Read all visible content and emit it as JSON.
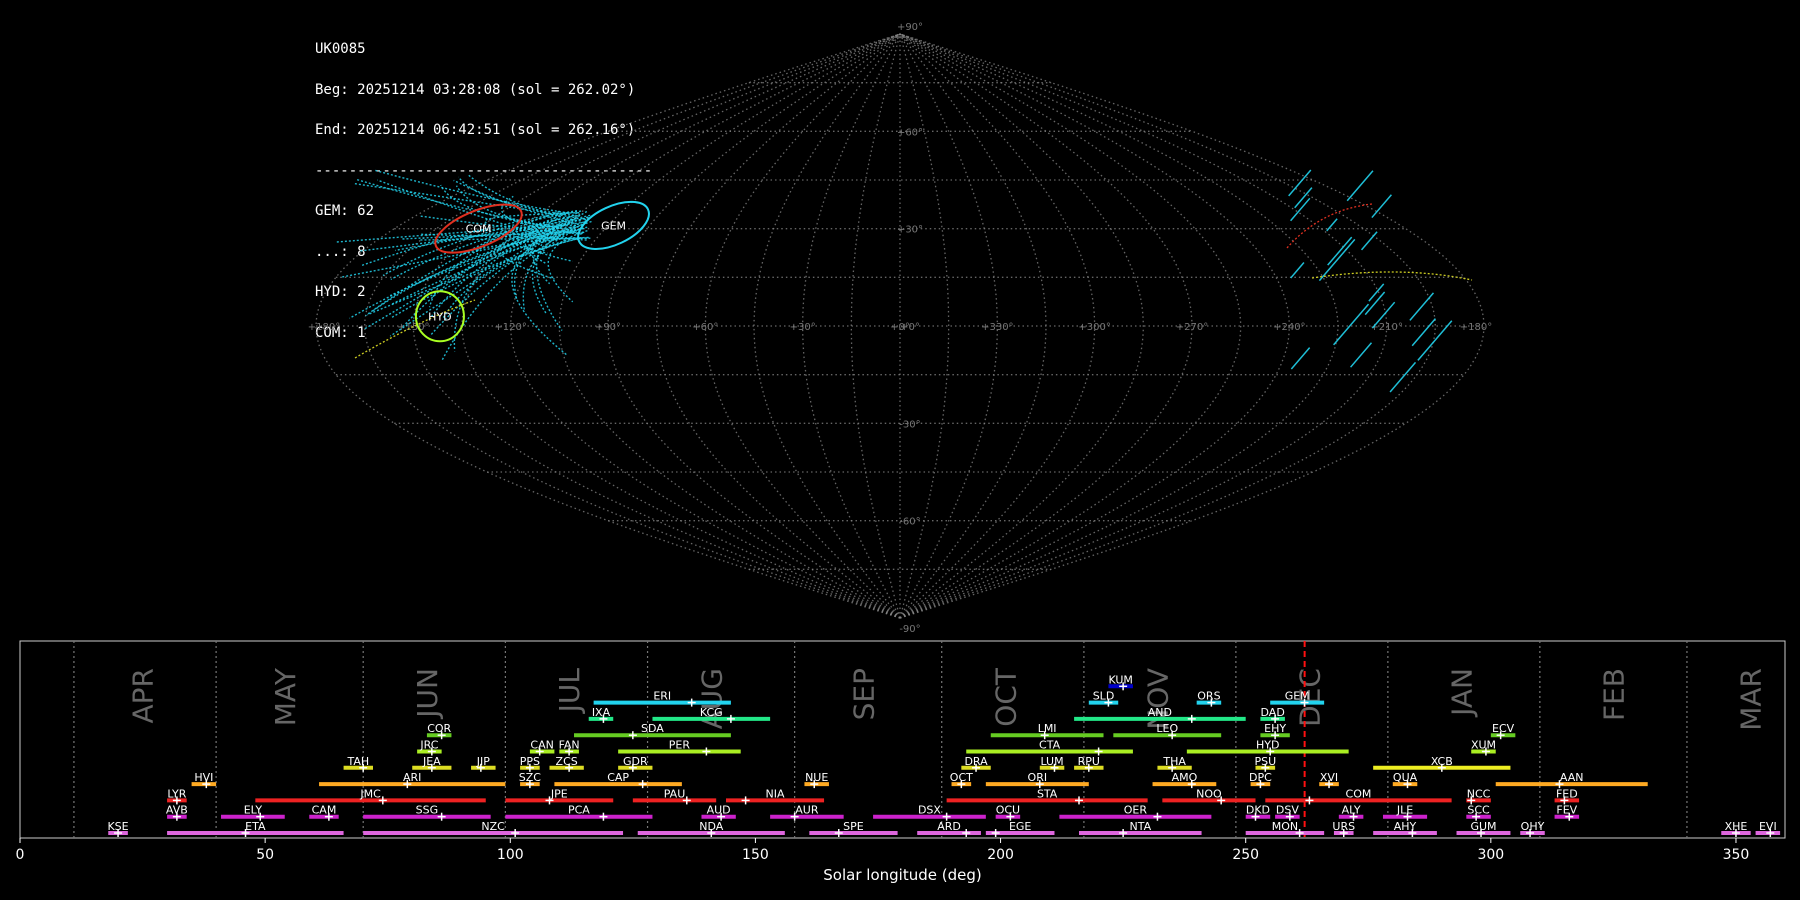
{
  "info": {
    "station": "UK0085",
    "beg": "Beg: 20251214 03:28:08 (sol = 262.02°)",
    "end": "End: 20251214 06:42:51 (sol = 262.16°)",
    "sep": "----------------------------------------",
    "counts": [
      "GEM: 62",
      "...: 8",
      "HYD: 2",
      "COM: 1"
    ]
  },
  "sky_map": {
    "projection": "sinusoidal",
    "lat_labels": [
      "+90°",
      "+60°",
      "+30°",
      "+0°",
      "-30°",
      "-60°",
      "-90°"
    ],
    "lon_labels": [
      "+180°",
      "+150°",
      "+120°",
      "+90°",
      "+60°",
      "+30°",
      "+0°",
      "+330°",
      "+300°",
      "+270°",
      "+240°",
      "+210°",
      "+180°"
    ],
    "radiants": [
      {
        "code": "COM",
        "lon": 150,
        "lat": 30,
        "color": "#e03020"
      },
      {
        "code": "GEM",
        "lon": 103,
        "lat": 31,
        "color": "#22d3ee"
      },
      {
        "code": "HYD",
        "lon": 142,
        "lat": 3,
        "color": "#aaff22"
      }
    ],
    "colors": {
      "grid": "#888888",
      "trail_gem": "#22d3ee",
      "trail_sporadic": "#cccc22",
      "trail_com": "#e03020"
    }
  },
  "chart_data": {
    "type": "bar",
    "xlabel": "Solar longitude (deg)",
    "xlim": [
      0,
      360
    ],
    "xticks": [
      0,
      50,
      100,
      150,
      200,
      250,
      300,
      350
    ],
    "current_sol": 262.02,
    "month_boundaries": [
      11,
      40,
      70,
      99,
      128,
      158,
      188,
      217,
      248,
      279,
      310,
      340
    ],
    "months": [
      {
        "name": "APR",
        "sol": 25
      },
      {
        "name": "MAY",
        "sol": 54
      },
      {
        "name": "JUN",
        "sol": 83
      },
      {
        "name": "JUL",
        "sol": 112
      },
      {
        "name": "AUG",
        "sol": 141
      },
      {
        "name": "SEP",
        "sol": 172
      },
      {
        "name": "OCT",
        "sol": 201
      },
      {
        "name": "NOV",
        "sol": 232
      },
      {
        "name": "DEC",
        "sol": 263
      },
      {
        "name": "JAN",
        "sol": 294
      },
      {
        "name": "FEB",
        "sol": 325
      },
      {
        "name": "MAR",
        "sol": 353
      }
    ],
    "showers": [
      {
        "code": "KUM",
        "start": 222,
        "end": 227,
        "peak": 225,
        "row": 10,
        "color": "#0000cc"
      },
      {
        "code": "ERI",
        "start": 117,
        "end": 145,
        "peak": 137,
        "row": 9,
        "color": "#22d3ee"
      },
      {
        "code": "SLD",
        "start": 218,
        "end": 224,
        "peak": 222,
        "row": 9,
        "color": "#22d3ee"
      },
      {
        "code": "ORS",
        "start": 240,
        "end": 245,
        "peak": 243,
        "row": 9,
        "color": "#22d3ee"
      },
      {
        "code": "GEM",
        "start": 255,
        "end": 266,
        "peak": 262,
        "row": 9,
        "color": "#22d3ee"
      },
      {
        "code": "IXA",
        "start": 116,
        "end": 121,
        "peak": 119,
        "row": 8,
        "color": "#22e888"
      },
      {
        "code": "KCG",
        "start": 129,
        "end": 153,
        "peak": 145,
        "row": 8,
        "color": "#22e888"
      },
      {
        "code": "AND",
        "start": 215,
        "end": 250,
        "peak": 239,
        "row": 8,
        "color": "#22e888"
      },
      {
        "code": "DAD",
        "start": 253,
        "end": 258,
        "peak": 256,
        "row": 8,
        "color": "#22e888"
      },
      {
        "code": "COR",
        "start": 83,
        "end": 88,
        "peak": 86,
        "row": 7,
        "color": "#66cc22"
      },
      {
        "code": "SDA",
        "start": 113,
        "end": 145,
        "peak": 125,
        "row": 7,
        "color": "#66cc22"
      },
      {
        "code": "LMI",
        "start": 198,
        "end": 221,
        "peak": 209,
        "row": 7,
        "color": "#66cc22"
      },
      {
        "code": "LEO",
        "start": 223,
        "end": 245,
        "peak": 235,
        "row": 7,
        "color": "#66cc22"
      },
      {
        "code": "EHY",
        "start": 253,
        "end": 259,
        "peak": 256,
        "row": 7,
        "color": "#66cc22"
      },
      {
        "code": "ECV",
        "start": 300,
        "end": 305,
        "peak": 302,
        "row": 7,
        "color": "#66cc22"
      },
      {
        "code": "JRC",
        "start": 81,
        "end": 86,
        "peak": 84,
        "row": 6,
        "color": "#aaee22"
      },
      {
        "code": "CAN",
        "start": 104,
        "end": 109,
        "peak": 106,
        "row": 6,
        "color": "#aaee22"
      },
      {
        "code": "FAN",
        "start": 110,
        "end": 114,
        "peak": 112,
        "row": 6,
        "color": "#aaee22"
      },
      {
        "code": "PER",
        "start": 122,
        "end": 147,
        "peak": 140,
        "row": 6,
        "color": "#aaee22"
      },
      {
        "code": "CTA",
        "start": 193,
        "end": 227,
        "peak": 220,
        "row": 6,
        "color": "#aaee22"
      },
      {
        "code": "HYD",
        "start": 238,
        "end": 271,
        "peak": 255,
        "row": 6,
        "color": "#aaee22"
      },
      {
        "code": "XUM",
        "start": 296,
        "end": 301,
        "peak": 299,
        "row": 6,
        "color": "#aaee22"
      },
      {
        "code": "TAH",
        "start": 66,
        "end": 72,
        "peak": 70,
        "row": 5,
        "color": "#dddd22"
      },
      {
        "code": "JEA",
        "start": 80,
        "end": 88,
        "peak": 84,
        "row": 5,
        "color": "#dddd22"
      },
      {
        "code": "JIP",
        "start": 92,
        "end": 97,
        "peak": 94,
        "row": 5,
        "color": "#dddd22"
      },
      {
        "code": "PPS",
        "start": 102,
        "end": 106,
        "peak": 104,
        "row": 5,
        "color": "#dddd22"
      },
      {
        "code": "ZCS",
        "start": 108,
        "end": 115,
        "peak": 112,
        "row": 5,
        "color": "#dddd22"
      },
      {
        "code": "GDR",
        "start": 122,
        "end": 129,
        "peak": 125,
        "row": 5,
        "color": "#dddd22"
      },
      {
        "code": "DRA",
        "start": 192,
        "end": 198,
        "peak": 195,
        "row": 5,
        "color": "#dddd22"
      },
      {
        "code": "LUM",
        "start": 208,
        "end": 213,
        "peak": 211,
        "row": 5,
        "color": "#dddd22"
      },
      {
        "code": "RPU",
        "start": 215,
        "end": 221,
        "peak": 218,
        "row": 5,
        "color": "#dddd22"
      },
      {
        "code": "THA",
        "start": 232,
        "end": 239,
        "peak": 235,
        "row": 5,
        "color": "#dddd22"
      },
      {
        "code": "PSU",
        "start": 252,
        "end": 256,
        "peak": 254,
        "row": 5,
        "color": "#dddd22"
      },
      {
        "code": "XCB",
        "start": 276,
        "end": 304,
        "peak": 290,
        "row": 5,
        "color": "#eeee22"
      },
      {
        "code": "HVI",
        "start": 35,
        "end": 40,
        "peak": 38,
        "row": 4,
        "color": "#ffaa22"
      },
      {
        "code": "ARI",
        "start": 61,
        "end": 99,
        "peak": 79,
        "row": 4,
        "color": "#ffaa22"
      },
      {
        "code": "SZC",
        "start": 102,
        "end": 106,
        "peak": 104,
        "row": 4,
        "color": "#ffaa22"
      },
      {
        "code": "CAP",
        "start": 109,
        "end": 135,
        "peak": 127,
        "row": 4,
        "color": "#ffaa22"
      },
      {
        "code": "NUE",
        "start": 160,
        "end": 165,
        "peak": 162,
        "row": 4,
        "color": "#ffaa22"
      },
      {
        "code": "OCT",
        "start": 190,
        "end": 194,
        "peak": 192,
        "row": 4,
        "color": "#ffaa22"
      },
      {
        "code": "ORI",
        "start": 197,
        "end": 218,
        "peak": 208,
        "row": 4,
        "color": "#ffaa22"
      },
      {
        "code": "AMO",
        "start": 231,
        "end": 244,
        "peak": 239,
        "row": 4,
        "color": "#ffaa22"
      },
      {
        "code": "DPC",
        "start": 251,
        "end": 255,
        "peak": 253,
        "row": 4,
        "color": "#ffaa22"
      },
      {
        "code": "XVI",
        "start": 265,
        "end": 269,
        "peak": 267,
        "row": 4,
        "color": "#ffaa22"
      },
      {
        "code": "QUA",
        "start": 280,
        "end": 285,
        "peak": 283,
        "row": 4,
        "color": "#ffaa22"
      },
      {
        "code": "AAN",
        "start": 301,
        "end": 332,
        "peak": 314,
        "row": 4,
        "color": "#ffaa22"
      },
      {
        "code": "LYR",
        "start": 30,
        "end": 34,
        "peak": 32,
        "row": 3,
        "color": "#ee2222"
      },
      {
        "code": "JMC",
        "start": 48,
        "end": 95,
        "peak": 74,
        "row": 3,
        "color": "#ee2222"
      },
      {
        "code": "JPE",
        "start": 99,
        "end": 121,
        "peak": 108,
        "row": 3,
        "color": "#ee2222"
      },
      {
        "code": "PAU",
        "start": 125,
        "end": 142,
        "peak": 136,
        "row": 3,
        "color": "#ee2222"
      },
      {
        "code": "NIA",
        "start": 144,
        "end": 164,
        "peak": 148,
        "row": 3,
        "color": "#ee2222"
      },
      {
        "code": "STA",
        "start": 189,
        "end": 230,
        "peak": 216,
        "row": 3,
        "color": "#ee2222"
      },
      {
        "code": "NOO",
        "start": 233,
        "end": 252,
        "peak": 245,
        "row": 3,
        "color": "#ee2222"
      },
      {
        "code": "COM",
        "start": 254,
        "end": 292,
        "peak": 263,
        "row": 3,
        "color": "#ee2222"
      },
      {
        "code": "NCC",
        "start": 295,
        "end": 300,
        "peak": 296,
        "row": 3,
        "color": "#ee2222"
      },
      {
        "code": "FED",
        "start": 313,
        "end": 318,
        "peak": 315,
        "row": 3,
        "color": "#ee2222"
      },
      {
        "code": "AVB",
        "start": 30,
        "end": 34,
        "peak": 32,
        "row": 2,
        "color": "#cc22cc"
      },
      {
        "code": "ELY",
        "start": 41,
        "end": 54,
        "peak": 49,
        "row": 2,
        "color": "#cc22cc"
      },
      {
        "code": "CAM",
        "start": 59,
        "end": 65,
        "peak": 63,
        "row": 2,
        "color": "#cc22cc"
      },
      {
        "code": "SSG",
        "start": 70,
        "end": 96,
        "peak": 86,
        "row": 2,
        "color": "#cc22cc"
      },
      {
        "code": "PCA",
        "start": 99,
        "end": 129,
        "peak": 119,
        "row": 2,
        "color": "#cc22cc"
      },
      {
        "code": "AUD",
        "start": 139,
        "end": 146,
        "peak": 143,
        "row": 2,
        "color": "#cc22cc"
      },
      {
        "code": "AUR",
        "start": 153,
        "end": 168,
        "peak": 158,
        "row": 2,
        "color": "#cc22cc"
      },
      {
        "code": "DSX",
        "start": 174,
        "end": 197,
        "peak": 189,
        "row": 2,
        "color": "#cc22cc"
      },
      {
        "code": "OCU",
        "start": 199,
        "end": 204,
        "peak": 202,
        "row": 2,
        "color": "#cc22cc"
      },
      {
        "code": "OER",
        "start": 212,
        "end": 243,
        "peak": 232,
        "row": 2,
        "color": "#cc22cc"
      },
      {
        "code": "DKD",
        "start": 250,
        "end": 255,
        "peak": 252,
        "row": 2,
        "color": "#cc22cc"
      },
      {
        "code": "DSV",
        "start": 256,
        "end": 261,
        "peak": 259,
        "row": 2,
        "color": "#cc22cc"
      },
      {
        "code": "ALY",
        "start": 269,
        "end": 274,
        "peak": 272,
        "row": 2,
        "color": "#cc22cc"
      },
      {
        "code": "JLE",
        "start": 278,
        "end": 287,
        "peak": 283,
        "row": 2,
        "color": "#cc22cc"
      },
      {
        "code": "SCC",
        "start": 295,
        "end": 300,
        "peak": 297,
        "row": 2,
        "color": "#cc22cc"
      },
      {
        "code": "FEV",
        "start": 313,
        "end": 318,
        "peak": 316,
        "row": 2,
        "color": "#cc22cc"
      },
      {
        "code": "KSE",
        "start": 18,
        "end": 22,
        "peak": 20,
        "row": 1,
        "color": "#dd66dd"
      },
      {
        "code": "ETA",
        "start": 30,
        "end": 66,
        "peak": 46,
        "row": 1,
        "color": "#dd66dd"
      },
      {
        "code": "NZC",
        "start": 70,
        "end": 123,
        "peak": 101,
        "row": 1,
        "color": "#dd66dd"
      },
      {
        "code": "NDA",
        "start": 126,
        "end": 156,
        "peak": 141,
        "row": 1,
        "color": "#dd66dd"
      },
      {
        "code": "SPE",
        "start": 161,
        "end": 179,
        "peak": 167,
        "row": 1,
        "color": "#dd66dd"
      },
      {
        "code": "ARD",
        "start": 183,
        "end": 196,
        "peak": 193,
        "row": 1,
        "color": "#dd66dd"
      },
      {
        "code": "EGE",
        "start": 197,
        "end": 211,
        "peak": 199,
        "row": 1,
        "color": "#dd66dd"
      },
      {
        "code": "NTA",
        "start": 216,
        "end": 241,
        "peak": 225,
        "row": 1,
        "color": "#dd66dd"
      },
      {
        "code": "MON",
        "start": 250,
        "end": 266,
        "peak": 261,
        "row": 1,
        "color": "#dd66dd"
      },
      {
        "code": "URS",
        "start": 268,
        "end": 272,
        "peak": 270,
        "row": 1,
        "color": "#dd66dd"
      },
      {
        "code": "AHY",
        "start": 276,
        "end": 289,
        "peak": 284,
        "row": 1,
        "color": "#dd66dd"
      },
      {
        "code": "GUM",
        "start": 293,
        "end": 304,
        "peak": 298,
        "row": 1,
        "color": "#dd66dd"
      },
      {
        "code": "OHY",
        "start": 306,
        "end": 311,
        "peak": 308,
        "row": 1,
        "color": "#dd66dd"
      },
      {
        "code": "XHE",
        "start": 347,
        "end": 353,
        "peak": 350,
        "row": 1,
        "color": "#dd66dd"
      },
      {
        "code": "EVI",
        "start": 354,
        "end": 359,
        "peak": 357,
        "row": 1,
        "color": "#dd66dd"
      }
    ]
  }
}
